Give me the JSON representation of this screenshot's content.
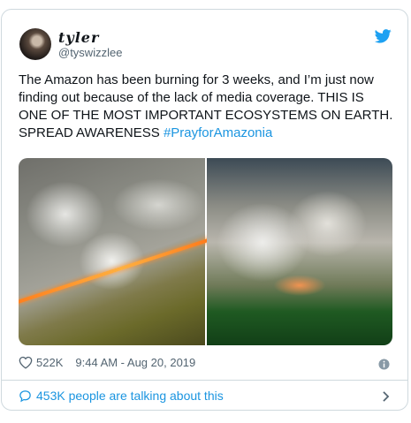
{
  "user": {
    "display_name": "tyler",
    "handle": "@tyswizzlee"
  },
  "tweet": {
    "text": "The Amazon has been burning for 3 weeks, and I’m just now finding out because of the lack of media coverage. THIS IS ONE OF THE MOST IMPORTANT ECOSYSTEMS ON EARTH. SPREAD AWARENESS ",
    "hashtag": "#PrayforAmazonia"
  },
  "media": {
    "images": [
      "amazon-fire-aerial-left",
      "amazon-fire-aerial-right"
    ]
  },
  "meta": {
    "likes": "522K",
    "timestamp": "9:44 AM - Aug 20, 2019"
  },
  "footer": {
    "talking_label": "453K people are talking about this"
  },
  "colors": {
    "link": "#1b95e0",
    "text": "#0f1419",
    "muted": "#536471",
    "border": "#cfd9de"
  },
  "icons": [
    "twitter-bird-icon",
    "heart-icon",
    "info-icon",
    "speech-bubble-icon",
    "chevron-right-icon"
  ]
}
